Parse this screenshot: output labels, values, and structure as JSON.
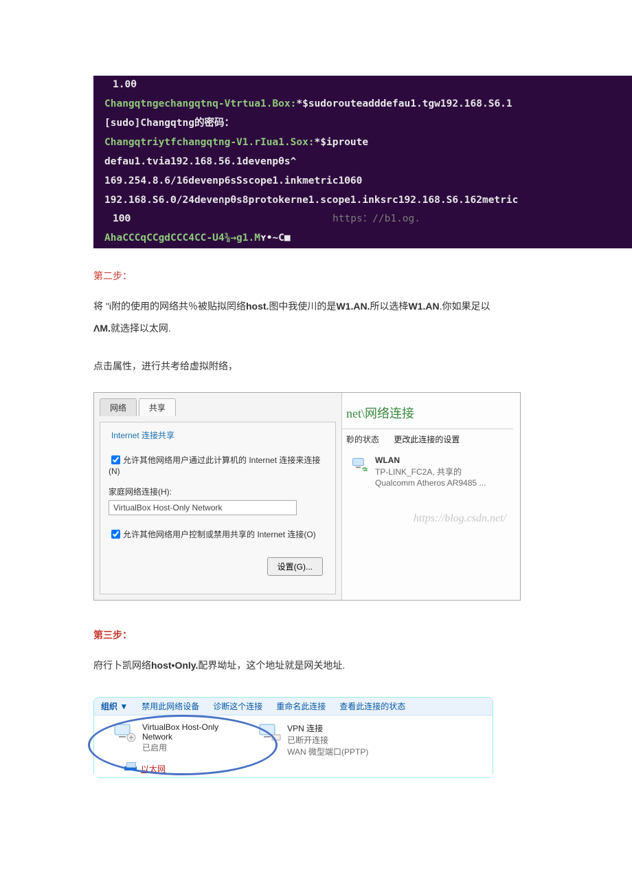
{
  "terminal": {
    "l1": "1.0θ",
    "l2a": "Changqtngechangqtnq-Vtrtua1.Box:",
    "l2b": "*$sudorouteadddefau1.tgw192.168.S6.1",
    "l3": "[sudo]Changqtng的密码：",
    "l4a": "Changqtriytfchangqtng-V1.rIua1.Sox:",
    "l4b": "*$iproute",
    "l5": "defau1.tvia192.168.56.1devenpθs^",
    "l6": "169.254.8.6/16devenp6sSscope1.inkmetric1Θ60",
    "l7": "192.168.S6.Θ/24deve∩pθs8protokerne1.scope1.inksrc192.168.S6.162metric",
    "l8a": "1ΘΘ",
    "l8b": "https：//b1.og.",
    "l9a": "AhaCCCqCCgdCCC4CC-U4⅜→g1.M",
    "l9b": "ʏ•~C■"
  },
  "step2": {
    "title": "第二步：",
    "p1_a": "将 \"i附的使用的网络共％被贴拟罔络",
    "p1_b": "host.",
    "p1_c": "图中我使川的是",
    "p1_d": "W1.AN.",
    "p1_e": "所以选栙",
    "p1_f": "W1.AN",
    "p1_g": ".你如果足以",
    "p1_h": "ΛM.",
    "p1_i": "就选择以太网.",
    "p2": "点击属性，进行共考给虚拟附络，"
  },
  "dialog": {
    "tab_net": "网络",
    "tab_share": "共享",
    "legend": "Internet 连接共享",
    "chk1": "允许其他网络用户通过此计算机的 Internet 连接来连接(N)",
    "home_label": "家庭网络连接(H):",
    "home_value": "VirtualBox Host-Only Network",
    "chk2": "允许其他网络用户控制或禁用共享的 Internet 连接(O)",
    "btn_settings": "设置(G)...",
    "right_title": "net\\网络连接",
    "right_status": "䩖的状态",
    "right_change": "更改此连接的设置",
    "wlan_title": "WLAN",
    "wlan_sub1": "TP-LINK_FC2A, 共享的",
    "wlan_sub2": "Qualcomm Atheros AR9485 ...",
    "watermark": "https://blog.csdn.net/"
  },
  "step3": {
    "title": "第三步：",
    "p1_a": "府行卜凯网络",
    "p1_b": "host•OnIy.",
    "p1_c": "配界坳址，这个地址就是网关地址."
  },
  "netpanel": {
    "org": "组织 ▼",
    "t1": "禁用此网络设备",
    "t2": "诊断这个连接",
    "t3": "重命名此连接",
    "t4": "查看此连接的状态",
    "vb_title": "VirtualBox Host-Only",
    "vb_title2": "Network",
    "vb_sub": "已启用",
    "vpn_title": "VPN 连接",
    "vpn_sub1": "已断开连接",
    "vpn_sub2": "WAN 微型端口(PPTP)",
    "eth": "以太网"
  }
}
